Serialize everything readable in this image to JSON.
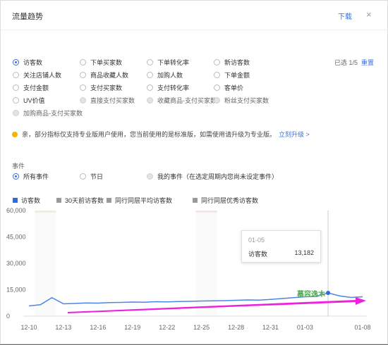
{
  "header": {
    "title": "流量趋势",
    "download": "下载",
    "close": "×"
  },
  "metrics": [
    {
      "label": "访客数",
      "state": "selected"
    },
    {
      "label": "下单买家数",
      "state": "normal"
    },
    {
      "label": "下单转化率",
      "state": "normal"
    },
    {
      "label": "新访客数",
      "state": "normal"
    },
    {
      "label": "关注店铺人数",
      "state": "normal"
    },
    {
      "label": "商品收藏人数",
      "state": "normal"
    },
    {
      "label": "加购人数",
      "state": "normal"
    },
    {
      "label": "下单金额",
      "state": "normal"
    },
    {
      "label": "支付金额",
      "state": "normal"
    },
    {
      "label": "支付买家数",
      "state": "normal"
    },
    {
      "label": "支付转化率",
      "state": "normal"
    },
    {
      "label": "客单价",
      "state": "normal"
    },
    {
      "label": "UV价值",
      "state": "normal"
    },
    {
      "label": "直接支付买家数",
      "state": "disabled"
    },
    {
      "label": "收藏商品-支付买家数",
      "state": "disabled"
    },
    {
      "label": "粉丝支付买家数",
      "state": "disabled"
    },
    {
      "label": "加购商品-支付买家数",
      "state": "disabled"
    }
  ],
  "selection": {
    "count": "已选 1/5",
    "reset": "重置"
  },
  "notice": {
    "text": "亲，部分指标仅支持专业版用户使用，您当前使用的是标准版，如需使用请升级为专业版。",
    "link": "立刻升级 >"
  },
  "events": {
    "label": "事件",
    "options": [
      {
        "label": "所有事件",
        "state": "selected"
      },
      {
        "label": "节日",
        "state": "normal"
      },
      {
        "label": "我的事件（在选定周期内您尚未设定事件）",
        "state": "disabled"
      }
    ]
  },
  "legend": [
    {
      "label": "访客数",
      "color": "#2f6bd9"
    },
    {
      "label": "30天前访客数",
      "color": "#9a9a9a"
    },
    {
      "label": "同行同层平均访客数",
      "color": "#9a9a9a"
    },
    {
      "label": "同行同层优秀访客数",
      "color": "#9a9a9a"
    }
  ],
  "chart_data": {
    "type": "line",
    "y_ticks": [
      "60,000",
      "45,000",
      "30,000",
      "15,000",
      "0"
    ],
    "ylim": [
      0,
      60000
    ],
    "x_ticks": [
      "12-10",
      "12-13",
      "12-16",
      "12-19",
      "12-22",
      "12-25",
      "12-28",
      "12-31",
      "01-03",
      "01-08"
    ],
    "x": [
      "12-10",
      "12-11",
      "12-12",
      "12-13",
      "12-14",
      "12-15",
      "12-16",
      "12-17",
      "12-18",
      "12-19",
      "12-20",
      "12-21",
      "12-22",
      "12-23",
      "12-24",
      "12-25",
      "12-26",
      "12-27",
      "12-28",
      "12-29",
      "12-30",
      "12-31",
      "01-01",
      "01-02",
      "01-03",
      "01-04",
      "01-05",
      "01-06",
      "01-07",
      "01-08"
    ],
    "series": [
      {
        "name": "访客数",
        "color": "#4a86e8",
        "values": [
          5800,
          6500,
          10500,
          7000,
          7200,
          7500,
          7400,
          7700,
          7800,
          8000,
          7900,
          8200,
          8100,
          8300,
          8400,
          8600,
          8700,
          8800,
          9000,
          9200,
          9100,
          9500,
          10000,
          10500,
          11000,
          11200,
          13182,
          11500,
          10600,
          11000
        ]
      }
    ],
    "tooltip": {
      "date": "01-05",
      "name": "访客数",
      "value": "13,182"
    },
    "highlight_dates": [
      "12-11",
      "12-25"
    ],
    "grid": false
  },
  "watermark": "慕容逸木"
}
